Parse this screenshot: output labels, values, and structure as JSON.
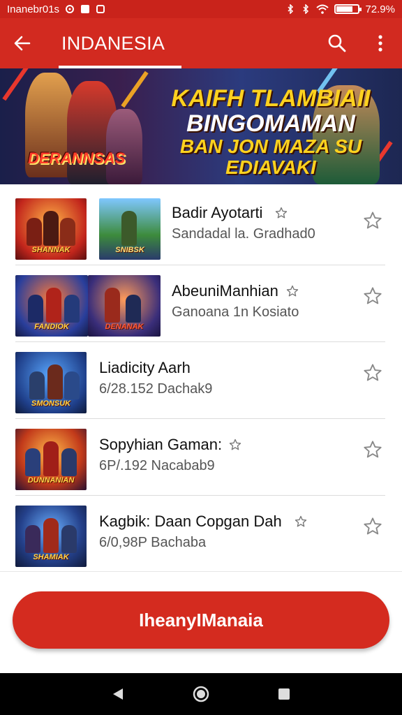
{
  "status_bar": {
    "carrier": "Inanebr01s",
    "time_battery": "72.9%",
    "battery_level": 0.72,
    "icons": [
      "settings-icon",
      "square-icon",
      "notification-icon",
      "bluetooth-icon",
      "bluetooth-icon",
      "wifi-icon",
      "battery-icon"
    ]
  },
  "app_bar": {
    "title": "INDANESIA",
    "back_icon": "arrow-left-icon",
    "search_icon": "search-icon",
    "menu_icon": "more-vert-icon"
  },
  "banner": {
    "line1": "KAIFH TLAMBIAII",
    "line2": "BINGOMAMAN",
    "line3": "BAN JON MAZA SU EDIAVAKI",
    "logo": "DERANNSAS"
  },
  "list": {
    "items": [
      {
        "title": "Badir Ayotarti",
        "subtitle": "Sandadal la. Gradhad0",
        "thumb_captions": [
          "SHANNAK",
          "SNIBSK"
        ],
        "has_title_star": true
      },
      {
        "title": "AbeuniManhian",
        "subtitle": "Ganoana 1n Kosiato",
        "thumb_captions": [
          "FANDIOK",
          "DENANAK"
        ],
        "has_title_star": true
      },
      {
        "title": "Liadicity Aarh",
        "subtitle": "6/28.152   Dachak9",
        "thumb_captions": [
          "SMONSUK"
        ],
        "has_title_star": false
      },
      {
        "title": "Sopyhian Gaman:",
        "subtitle": "6P/.192   Nacabab9",
        "thumb_captions": [
          "DUNNANIAN"
        ],
        "has_title_star": true
      },
      {
        "title": "Kagbik:  Daan Copgan Dah",
        "subtitle": "6/0,98P   Bachaba",
        "thumb_captions": [
          "SHAMIAK"
        ],
        "has_title_star": true
      }
    ]
  },
  "cta": {
    "label": "IheanyIManaia"
  },
  "nav_bar": {
    "back": "back-triangle-icon",
    "home": "home-circle-icon",
    "recents": "recents-square-icon"
  },
  "colors": {
    "primary": "#d22a20",
    "status": "#c9231b",
    "text": "#111111",
    "subtext": "#555555"
  }
}
